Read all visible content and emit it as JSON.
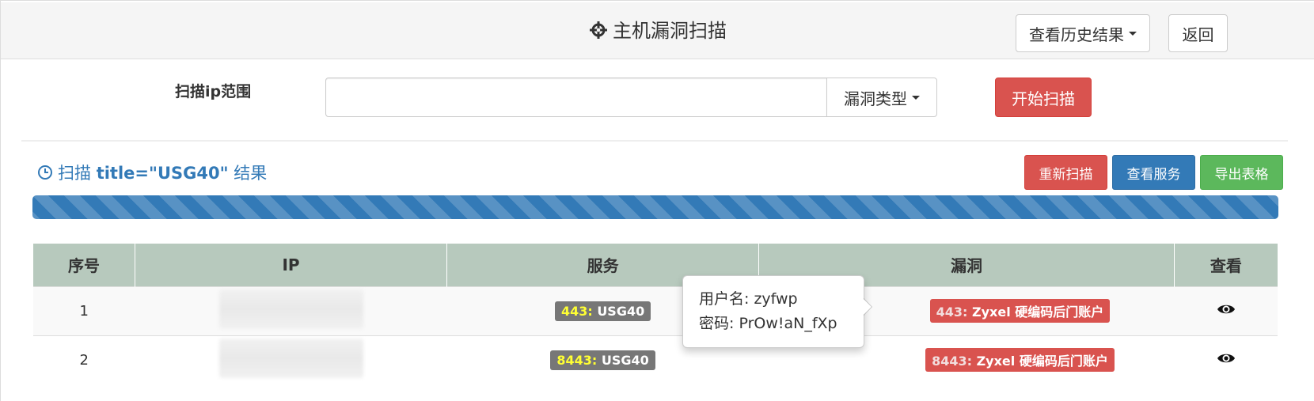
{
  "header": {
    "title": "主机漏洞扫描",
    "history_button": "查看历史结果",
    "back_button": "返回"
  },
  "scan_form": {
    "range_label": "扫描ip范围",
    "ip_input_value": "",
    "vuln_type_button": "漏洞类型",
    "start_button": "开始扫描"
  },
  "result": {
    "prefix": "扫描",
    "query": "title=\"USG40\"",
    "suffix": "结果",
    "rescan_button": "重新扫描",
    "view_services_button": "查看服务",
    "export_button": "导出表格",
    "progress_percent": 100
  },
  "table": {
    "headers": [
      "序号",
      "IP",
      "服务",
      "漏洞",
      "查看"
    ],
    "rows": [
      {
        "index": "1",
        "service_port": "443:",
        "service_name": "USG40",
        "vuln_port": "443:",
        "vuln_name": "Zyxel 硬编码后门账户"
      },
      {
        "index": "2",
        "service_port": "8443:",
        "service_name": "USG40",
        "vuln_port": "8443:",
        "vuln_name": "Zyxel 硬编码后门账户"
      }
    ]
  },
  "popover": {
    "username_line": "用户名: zyfwp",
    "password_line": "密码: PrOw!aN_fXp"
  },
  "colors": {
    "danger": "#d9534f",
    "primary": "#337ab7",
    "success": "#5cb85c",
    "table_header": "#b7c9bd"
  },
  "icons": {
    "title": "crosshair-icon",
    "result": "clock-icon",
    "view": "eye-icon"
  }
}
